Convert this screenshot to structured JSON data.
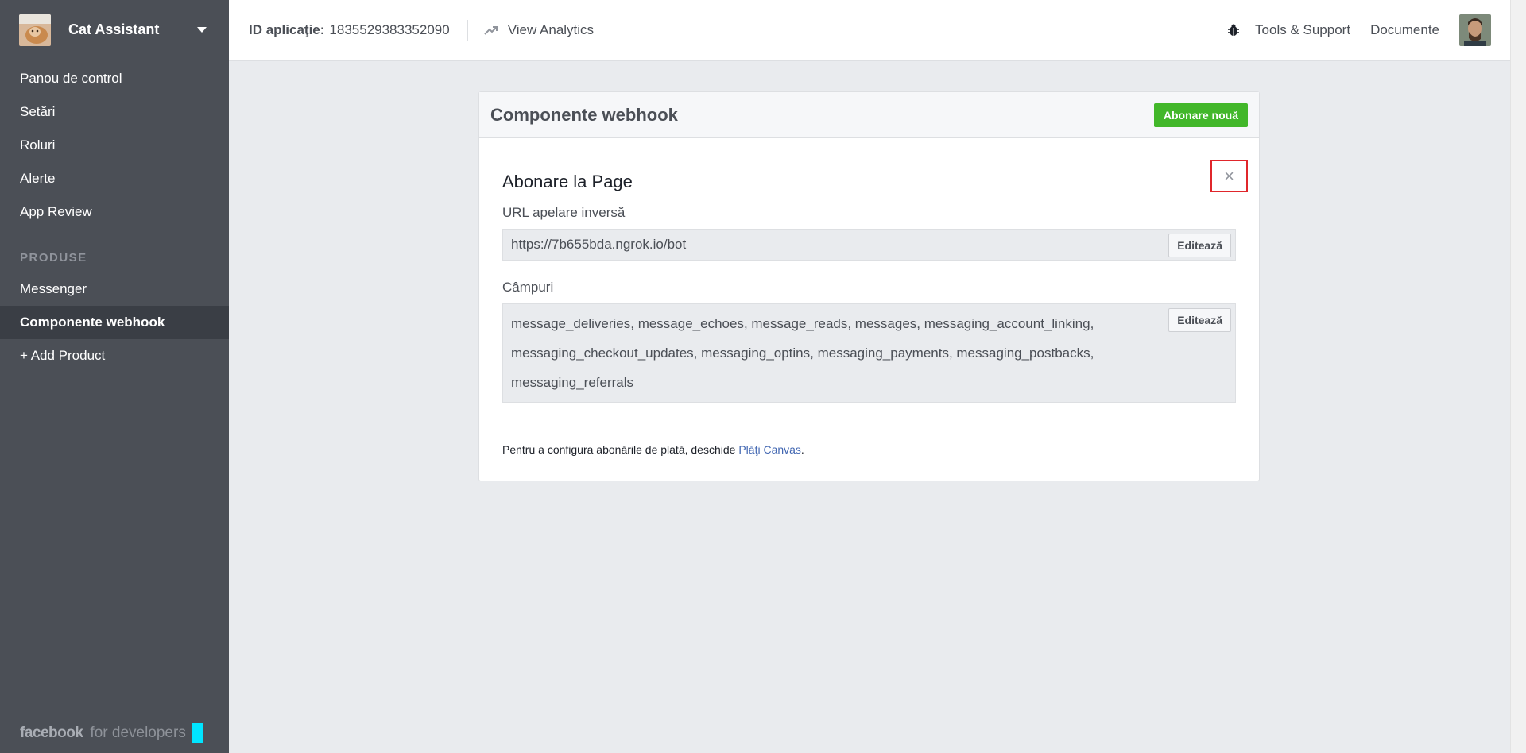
{
  "sidebar": {
    "app_name": "Cat Assistant",
    "nav_items": [
      {
        "label": "Panou de control"
      },
      {
        "label": "Setări"
      },
      {
        "label": "Roluri"
      },
      {
        "label": "Alerte"
      },
      {
        "label": "App Review"
      }
    ],
    "section_title": "PRODUSE",
    "product_items": [
      {
        "label": "Messenger"
      },
      {
        "label": "Componente webhook"
      },
      {
        "label": "+ Add Product"
      }
    ],
    "brand_word": "facebook",
    "brand_suffix": "for developers",
    "brand_color": "#00e5ff"
  },
  "topbar": {
    "id_label": "ID aplicaţie:",
    "id_value": "1835529383352090",
    "analytics_label": "View Analytics",
    "tools_label": "Tools & Support",
    "docs_label": "Documente",
    "icons": [
      "trend-icon",
      "bug-icon",
      "avatar"
    ]
  },
  "card": {
    "title": "Componente webhook",
    "new_button": "Abonare nouă",
    "subscription_title": "Abonare la Page",
    "close_symbol": "×",
    "url_label": "URL apelare inversă",
    "url_value": "https://7b655bda.ngrok.io/bot",
    "fields_label": "Câmpuri",
    "fields_lines": [
      "message_deliveries, message_echoes, message_reads, messages, messaging_account_linking,",
      "messaging_checkout_updates, messaging_optins, messaging_payments, messaging_postbacks,",
      "messaging_referrals"
    ],
    "edit_label": "Editează",
    "footer_text": "Pentru a configura abonările de plată, deschide ",
    "footer_link": "Plăţi Canvas",
    "footer_end": ".",
    "accent_green": "#42b72a",
    "highlight_red": "#e0262b"
  }
}
